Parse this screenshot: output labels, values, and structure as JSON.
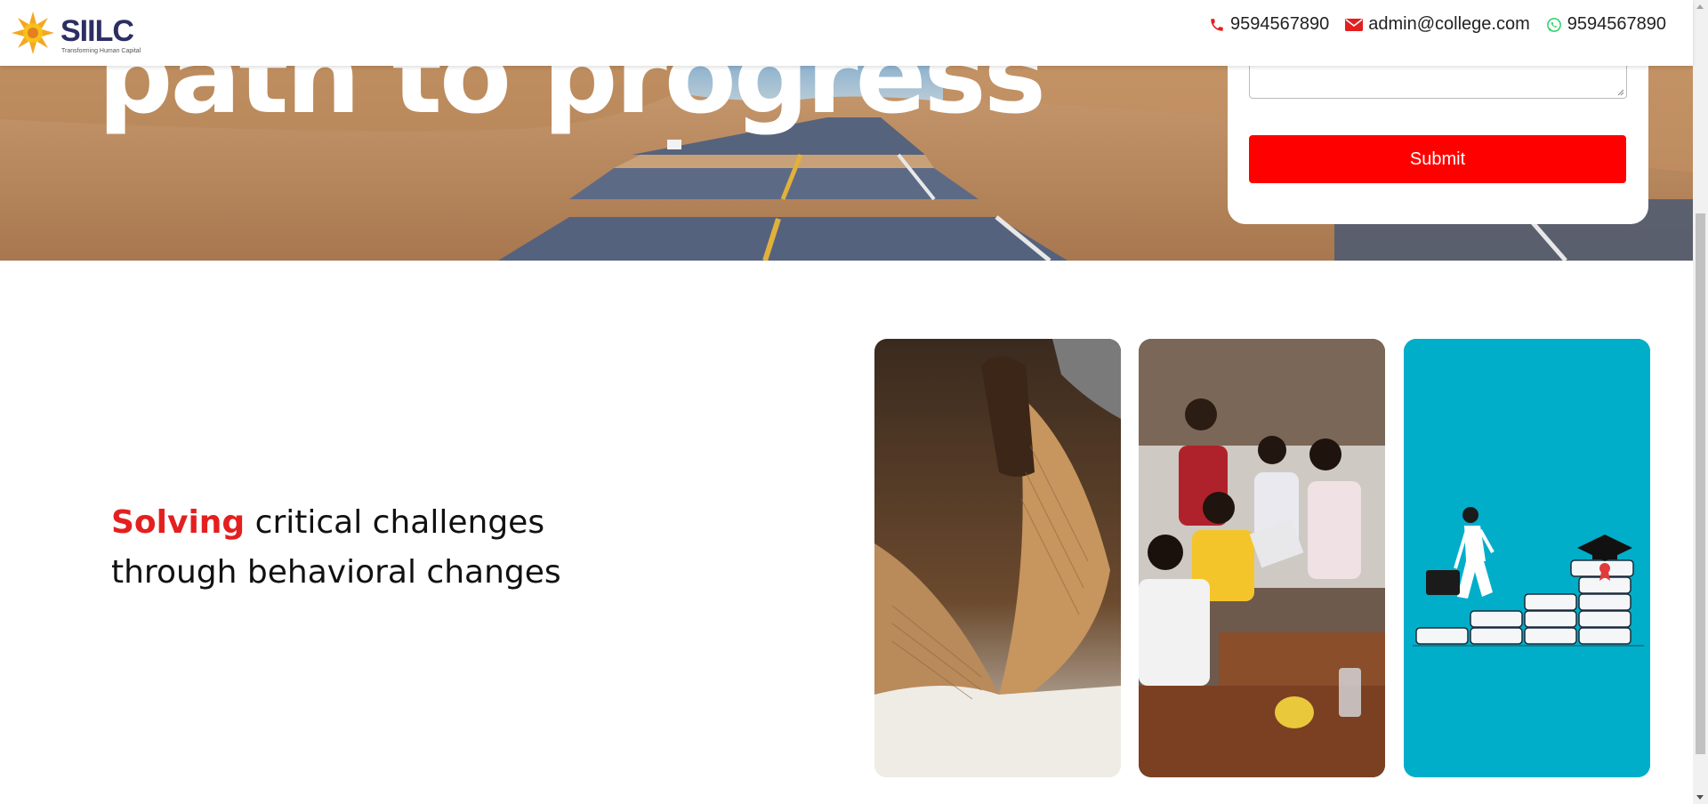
{
  "header": {
    "logo_text": "SIILC",
    "logo_tagline": "Transforming Human Capital",
    "phone": "9594567890",
    "email": "admin@college.com",
    "whatsapp": "9594567890",
    "icons": [
      "phone-icon",
      "envelope-icon",
      "whatsapp-icon"
    ]
  },
  "hero": {
    "title": "path to progress",
    "form": {
      "submit_label": "Submit"
    }
  },
  "section": {
    "tagline_highlight": "Solving",
    "tagline_rest_line1": " critical challenges",
    "tagline_line2": "through behavioral changes"
  },
  "colors": {
    "accent_red": "#ff0000",
    "highlight_red": "#e41f1f",
    "teal": "#00aec9",
    "logo_navy": "#2d2e63",
    "logo_orange": "#f5a623"
  }
}
